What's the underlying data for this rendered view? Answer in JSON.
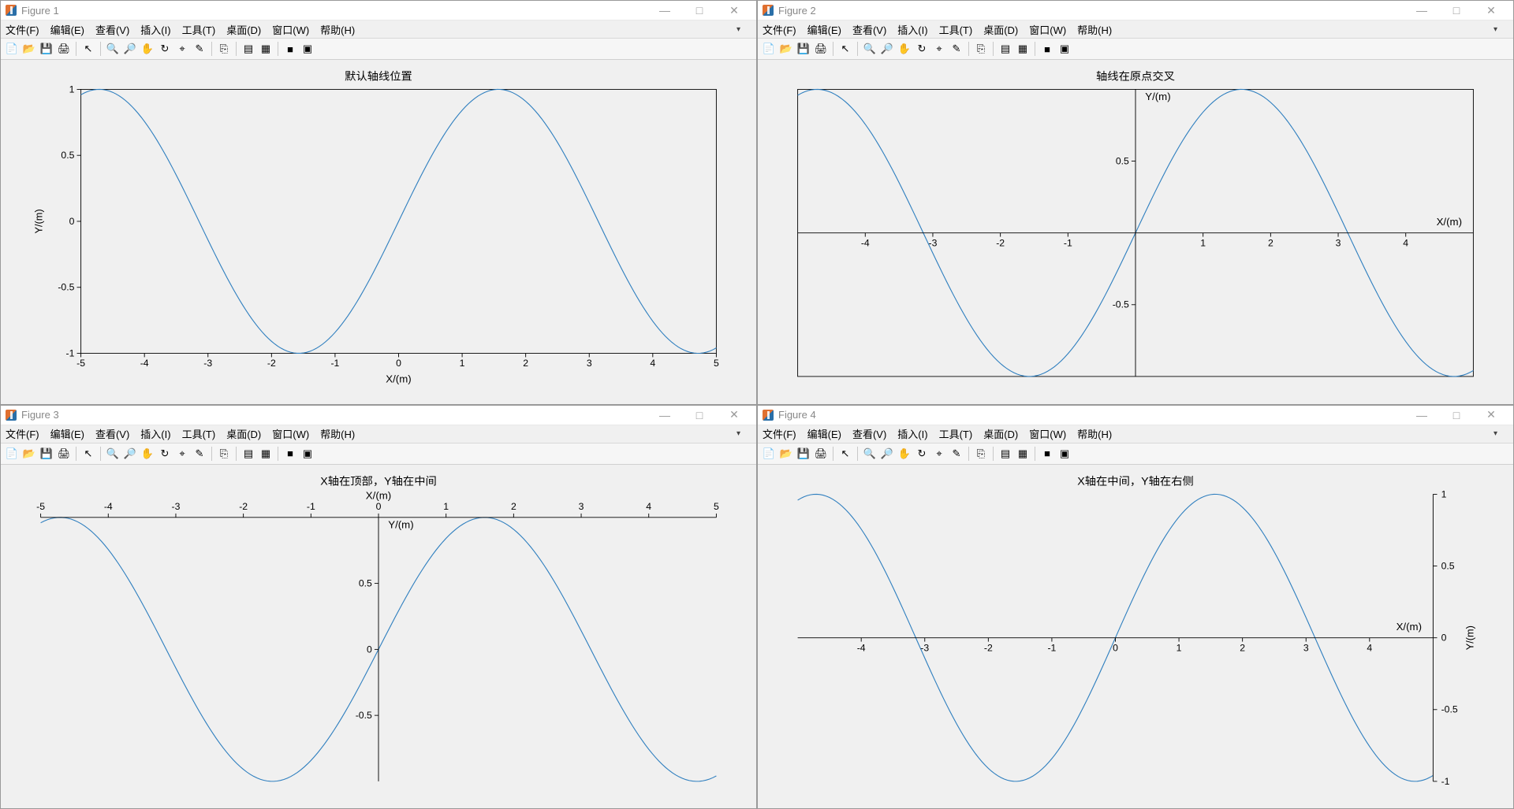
{
  "figures": [
    {
      "title": "Figure 1",
      "plot_title": "默认轴线位置",
      "xlabel": "X/(m)",
      "ylabel": "Y/(m)",
      "xticks": [
        -5,
        -4,
        -3,
        -2,
        -1,
        0,
        1,
        2,
        3,
        4,
        5
      ],
      "yticks": [
        -1,
        -0.5,
        0,
        0.5,
        1
      ],
      "xaxis_loc": "bottom",
      "yaxis_loc": "left",
      "box": true
    },
    {
      "title": "Figure 2",
      "plot_title": "轴线在原点交叉",
      "xlabel": "X/(m)",
      "ylabel": "Y/(m)",
      "xticks": [
        -4,
        -3,
        -2,
        -1,
        1,
        2,
        3,
        4
      ],
      "yticks": [
        -0.5,
        0.5
      ],
      "xaxis_loc": "origin",
      "yaxis_loc": "origin",
      "box": true
    },
    {
      "title": "Figure 3",
      "plot_title": "X轴在顶部，Y轴在中间",
      "xlabel": "X/(m)",
      "ylabel": "Y/(m)",
      "xticks": [
        -5,
        -4,
        -3,
        -2,
        -1,
        0,
        1,
        2,
        3,
        4,
        5
      ],
      "yticks": [
        -0.5,
        0,
        0.5
      ],
      "xaxis_loc": "top",
      "yaxis_loc": "origin",
      "box": false
    },
    {
      "title": "Figure 4",
      "plot_title": "X轴在中间，Y轴在右侧",
      "xlabel": "X/(m)",
      "ylabel": "Y/(m)",
      "xticks": [
        -4,
        -3,
        -2,
        -1,
        0,
        1,
        2,
        3,
        4
      ],
      "yticks": [
        -1,
        -0.5,
        0,
        0.5,
        1
      ],
      "xaxis_loc": "origin",
      "yaxis_loc": "right",
      "box": false
    }
  ],
  "menu_items": [
    "文件(F)",
    "编辑(E)",
    "查看(V)",
    "插入(I)",
    "工具(T)",
    "桌面(D)",
    "窗口(W)",
    "帮助(H)"
  ],
  "win_buttons": {
    "min": "—",
    "max": "□",
    "close": "✕"
  },
  "toolbar_icons": [
    {
      "name": "new-icon",
      "g": "📄"
    },
    {
      "name": "open-icon",
      "g": "📂"
    },
    {
      "name": "save-icon",
      "g": "💾"
    },
    {
      "name": "print-icon",
      "g": "🖨"
    },
    "|",
    {
      "name": "pointer-icon",
      "g": "↖"
    },
    "|",
    {
      "name": "zoom-in-icon",
      "g": "🔍"
    },
    {
      "name": "zoom-out-icon",
      "g": "🔎"
    },
    {
      "name": "pan-icon",
      "g": "✋"
    },
    {
      "name": "rotate-icon",
      "g": "↻"
    },
    {
      "name": "data-cursor-icon",
      "g": "⌖"
    },
    {
      "name": "brush-icon",
      "g": "✎"
    },
    "|",
    {
      "name": "link-icon",
      "g": "⎘"
    },
    "|",
    {
      "name": "insert-colorbar-icon",
      "g": "▤"
    },
    {
      "name": "insert-legend-icon",
      "g": "▦"
    },
    "|",
    {
      "name": "hide-tools-icon",
      "g": "■"
    },
    {
      "name": "dock-icon",
      "g": "▣"
    }
  ],
  "chart_data": [
    {
      "type": "line",
      "title": "默认轴线位置",
      "xlabel": "X/(m)",
      "ylabel": "Y/(m)",
      "xlim": [
        -5,
        5
      ],
      "ylim": [
        -1,
        1
      ],
      "series": [
        {
          "name": "sin(x)",
          "fn": "sin",
          "domain": [
            -5,
            5
          ],
          "n": 200
        }
      ],
      "xaxis_location": "bottom",
      "yaxis_location": "left",
      "box": true
    },
    {
      "type": "line",
      "title": "轴线在原点交叉",
      "xlabel": "X/(m)",
      "ylabel": "Y/(m)",
      "xlim": [
        -5,
        5
      ],
      "ylim": [
        -1,
        1
      ],
      "series": [
        {
          "name": "sin(x)",
          "fn": "sin",
          "domain": [
            -5,
            5
          ],
          "n": 200
        }
      ],
      "xaxis_location": "origin",
      "yaxis_location": "origin",
      "box": true
    },
    {
      "type": "line",
      "title": "X轴在顶部，Y轴在中间",
      "xlabel": "X/(m)",
      "ylabel": "Y/(m)",
      "xlim": [
        -5,
        5
      ],
      "ylim": [
        -1,
        1
      ],
      "series": [
        {
          "name": "sin(x)",
          "fn": "sin",
          "domain": [
            -5,
            5
          ],
          "n": 200
        }
      ],
      "xaxis_location": "top",
      "yaxis_location": "origin",
      "box": false
    },
    {
      "type": "line",
      "title": "X轴在中间，Y轴在右侧",
      "xlabel": "X/(m)",
      "ylabel": "Y/(m)",
      "xlim": [
        -5,
        5
      ],
      "ylim": [
        -1,
        1
      ],
      "series": [
        {
          "name": "sin(x)",
          "fn": "sin",
          "domain": [
            -5,
            5
          ],
          "n": 200
        }
      ],
      "xaxis_location": "origin",
      "yaxis_location": "right",
      "box": false
    }
  ]
}
